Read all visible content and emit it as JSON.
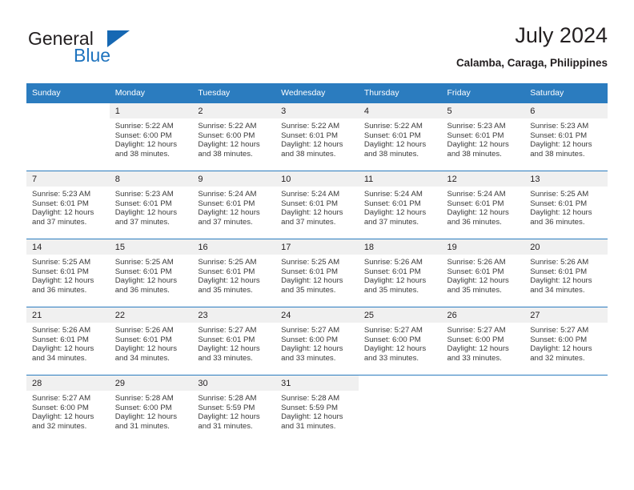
{
  "brand": {
    "word_one": "General",
    "word_two": "Blue",
    "accent_color": "#1668b3"
  },
  "header": {
    "title": "July 2024",
    "location": "Calamba, Caraga, Philippines"
  },
  "calendar": {
    "header_bg": "#2b7cbf",
    "daynum_bg": "#f0f0f0",
    "weekday_headers": [
      "Sunday",
      "Monday",
      "Tuesday",
      "Wednesday",
      "Thursday",
      "Friday",
      "Saturday"
    ],
    "labels": {
      "sunrise": "Sunrise:",
      "sunset": "Sunset:",
      "daylight": "Daylight:"
    },
    "weeks": [
      [
        {
          "day": "",
          "line1": "",
          "line2": "",
          "line3": "",
          "line4": "",
          "blank": true
        },
        {
          "day": "1",
          "line1": "Sunrise: 5:22 AM",
          "line2": "Sunset: 6:00 PM",
          "line3": "Daylight: 12 hours",
          "line4": "and 38 minutes."
        },
        {
          "day": "2",
          "line1": "Sunrise: 5:22 AM",
          "line2": "Sunset: 6:00 PM",
          "line3": "Daylight: 12 hours",
          "line4": "and 38 minutes."
        },
        {
          "day": "3",
          "line1": "Sunrise: 5:22 AM",
          "line2": "Sunset: 6:01 PM",
          "line3": "Daylight: 12 hours",
          "line4": "and 38 minutes."
        },
        {
          "day": "4",
          "line1": "Sunrise: 5:22 AM",
          "line2": "Sunset: 6:01 PM",
          "line3": "Daylight: 12 hours",
          "line4": "and 38 minutes."
        },
        {
          "day": "5",
          "line1": "Sunrise: 5:23 AM",
          "line2": "Sunset: 6:01 PM",
          "line3": "Daylight: 12 hours",
          "line4": "and 38 minutes."
        },
        {
          "day": "6",
          "line1": "Sunrise: 5:23 AM",
          "line2": "Sunset: 6:01 PM",
          "line3": "Daylight: 12 hours",
          "line4": "and 38 minutes."
        }
      ],
      [
        {
          "day": "7",
          "line1": "Sunrise: 5:23 AM",
          "line2": "Sunset: 6:01 PM",
          "line3": "Daylight: 12 hours",
          "line4": "and 37 minutes."
        },
        {
          "day": "8",
          "line1": "Sunrise: 5:23 AM",
          "line2": "Sunset: 6:01 PM",
          "line3": "Daylight: 12 hours",
          "line4": "and 37 minutes."
        },
        {
          "day": "9",
          "line1": "Sunrise: 5:24 AM",
          "line2": "Sunset: 6:01 PM",
          "line3": "Daylight: 12 hours",
          "line4": "and 37 minutes."
        },
        {
          "day": "10",
          "line1": "Sunrise: 5:24 AM",
          "line2": "Sunset: 6:01 PM",
          "line3": "Daylight: 12 hours",
          "line4": "and 37 minutes."
        },
        {
          "day": "11",
          "line1": "Sunrise: 5:24 AM",
          "line2": "Sunset: 6:01 PM",
          "line3": "Daylight: 12 hours",
          "line4": "and 37 minutes."
        },
        {
          "day": "12",
          "line1": "Sunrise: 5:24 AM",
          "line2": "Sunset: 6:01 PM",
          "line3": "Daylight: 12 hours",
          "line4": "and 36 minutes."
        },
        {
          "day": "13",
          "line1": "Sunrise: 5:25 AM",
          "line2": "Sunset: 6:01 PM",
          "line3": "Daylight: 12 hours",
          "line4": "and 36 minutes."
        }
      ],
      [
        {
          "day": "14",
          "line1": "Sunrise: 5:25 AM",
          "line2": "Sunset: 6:01 PM",
          "line3": "Daylight: 12 hours",
          "line4": "and 36 minutes."
        },
        {
          "day": "15",
          "line1": "Sunrise: 5:25 AM",
          "line2": "Sunset: 6:01 PM",
          "line3": "Daylight: 12 hours",
          "line4": "and 36 minutes."
        },
        {
          "day": "16",
          "line1": "Sunrise: 5:25 AM",
          "line2": "Sunset: 6:01 PM",
          "line3": "Daylight: 12 hours",
          "line4": "and 35 minutes."
        },
        {
          "day": "17",
          "line1": "Sunrise: 5:25 AM",
          "line2": "Sunset: 6:01 PM",
          "line3": "Daylight: 12 hours",
          "line4": "and 35 minutes."
        },
        {
          "day": "18",
          "line1": "Sunrise: 5:26 AM",
          "line2": "Sunset: 6:01 PM",
          "line3": "Daylight: 12 hours",
          "line4": "and 35 minutes."
        },
        {
          "day": "19",
          "line1": "Sunrise: 5:26 AM",
          "line2": "Sunset: 6:01 PM",
          "line3": "Daylight: 12 hours",
          "line4": "and 35 minutes."
        },
        {
          "day": "20",
          "line1": "Sunrise: 5:26 AM",
          "line2": "Sunset: 6:01 PM",
          "line3": "Daylight: 12 hours",
          "line4": "and 34 minutes."
        }
      ],
      [
        {
          "day": "21",
          "line1": "Sunrise: 5:26 AM",
          "line2": "Sunset: 6:01 PM",
          "line3": "Daylight: 12 hours",
          "line4": "and 34 minutes."
        },
        {
          "day": "22",
          "line1": "Sunrise: 5:26 AM",
          "line2": "Sunset: 6:01 PM",
          "line3": "Daylight: 12 hours",
          "line4": "and 34 minutes."
        },
        {
          "day": "23",
          "line1": "Sunrise: 5:27 AM",
          "line2": "Sunset: 6:01 PM",
          "line3": "Daylight: 12 hours",
          "line4": "and 33 minutes."
        },
        {
          "day": "24",
          "line1": "Sunrise: 5:27 AM",
          "line2": "Sunset: 6:00 PM",
          "line3": "Daylight: 12 hours",
          "line4": "and 33 minutes."
        },
        {
          "day": "25",
          "line1": "Sunrise: 5:27 AM",
          "line2": "Sunset: 6:00 PM",
          "line3": "Daylight: 12 hours",
          "line4": "and 33 minutes."
        },
        {
          "day": "26",
          "line1": "Sunrise: 5:27 AM",
          "line2": "Sunset: 6:00 PM",
          "line3": "Daylight: 12 hours",
          "line4": "and 33 minutes."
        },
        {
          "day": "27",
          "line1": "Sunrise: 5:27 AM",
          "line2": "Sunset: 6:00 PM",
          "line3": "Daylight: 12 hours",
          "line4": "and 32 minutes."
        }
      ],
      [
        {
          "day": "28",
          "line1": "Sunrise: 5:27 AM",
          "line2": "Sunset: 6:00 PM",
          "line3": "Daylight: 12 hours",
          "line4": "and 32 minutes."
        },
        {
          "day": "29",
          "line1": "Sunrise: 5:28 AM",
          "line2": "Sunset: 6:00 PM",
          "line3": "Daylight: 12 hours",
          "line4": "and 31 minutes."
        },
        {
          "day": "30",
          "line1": "Sunrise: 5:28 AM",
          "line2": "Sunset: 5:59 PM",
          "line3": "Daylight: 12 hours",
          "line4": "and 31 minutes."
        },
        {
          "day": "31",
          "line1": "Sunrise: 5:28 AM",
          "line2": "Sunset: 5:59 PM",
          "line3": "Daylight: 12 hours",
          "line4": "and 31 minutes."
        },
        {
          "day": "",
          "line1": "",
          "line2": "",
          "line3": "",
          "line4": "",
          "blank": true
        },
        {
          "day": "",
          "line1": "",
          "line2": "",
          "line3": "",
          "line4": "",
          "blank": true
        },
        {
          "day": "",
          "line1": "",
          "line2": "",
          "line3": "",
          "line4": "",
          "blank": true
        }
      ]
    ]
  }
}
